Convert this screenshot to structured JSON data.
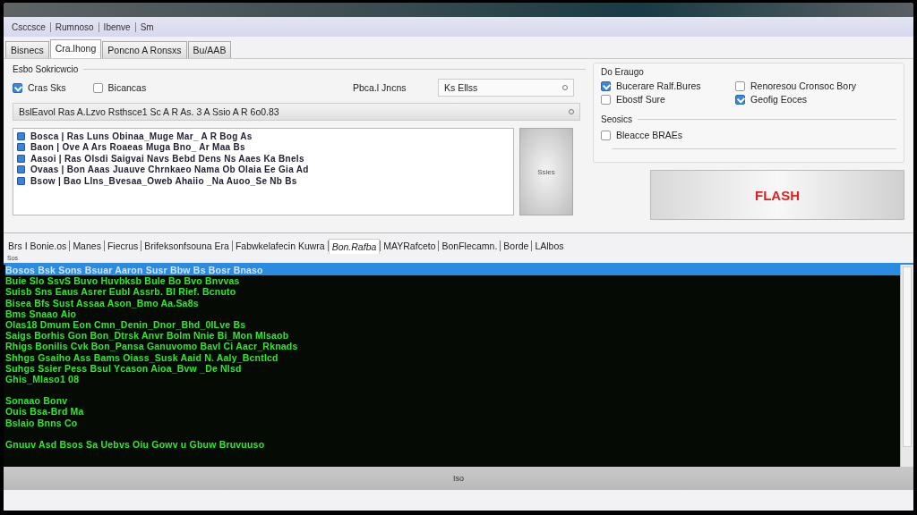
{
  "menu": [
    "Csccsce",
    "Rumnoso",
    "Ibenve",
    "Sm"
  ],
  "tabs": [
    {
      "label": "Bisnecs",
      "selected": false
    },
    {
      "label": "Cra.lhong",
      "selected": true
    },
    {
      "label": "Poncno A Ronsxs",
      "selected": false
    },
    {
      "label": "Bu/AAB",
      "selected": false
    }
  ],
  "settings": {
    "legend": "Esbo Sokricwcio",
    "checkboxes": [
      {
        "label": "Cras Sks",
        "checked": true
      },
      {
        "label": "Bicancas",
        "checked": false
      }
    ],
    "port_label": "Pbca.l Jncns",
    "port_value": "Ks Ellss",
    "file_value": "BslEavol Ras A.Lzvo Rsthsce1 Sc A R As. 3 A Ssio A R 6o0.83",
    "files": [
      "Bosca | Ras Luns Obinaa_Muge Mar_ A R Bog As",
      "Baon | Ove A Ars Roaeas Muga Bno_ Ar Maa Bs",
      "Aasoi | Ras Olsdi Saigvai Navs Bebd Dens Ns Aaes Ka Bnels",
      "Ovaas | Bon Aaas Juauve Chrnkaeo Nama Ob Olaia Ee Gia Ad",
      "Bsow | Bao Llns_Bvesaa_Oweb Ahaiio _Na Auoo_Se Nb Bs"
    ],
    "side_button": "Ssles"
  },
  "options": {
    "legend": "Do Eraugo",
    "checkboxes": [
      {
        "label": "Bucerare Ralf.Bures",
        "checked": true
      },
      {
        "label": "Renoresou Cronsoc Bory",
        "checked": false
      },
      {
        "label": "Ebostf Sure",
        "checked": false
      },
      {
        "label": "Geofig Eoces",
        "checked": true
      }
    ],
    "sub_legend": "Seosics",
    "sub_checkboxes": [
      {
        "label": "Bleacce BRAEs",
        "checked": false
      }
    ]
  },
  "flash_button": "FLASH",
  "log_tabs": [
    {
      "label": "Brs I Bonie.os",
      "selected": false
    },
    {
      "label": "Manes",
      "selected": false
    },
    {
      "label": "Fiecrus",
      "selected": false
    },
    {
      "label": "Brifeksonfsouna Era",
      "selected": false
    },
    {
      "label": "Fabwkelafecin Kuwra",
      "selected": false
    },
    {
      "label": "Bon.Rafba",
      "selected": true
    },
    {
      "label": "MAYRafceto",
      "selected": false
    },
    {
      "label": "BonFlecamn.",
      "selected": false
    },
    {
      "label": "Borde",
      "selected": false
    },
    {
      "label": "LAlbos",
      "selected": false
    }
  ],
  "log_caption": "Sos",
  "log": [
    {
      "text": "Bosos Bsk Sons Bsuar Aaron Susr Bbw Bs Bosr Bnaso",
      "selected": true
    },
    {
      "text": "Buie Slo SsvS Buvo Huvbksb Bule Bo Bvo Bnvvas",
      "selected": false
    },
    {
      "text": "Suisb Sns Eaus Asrer Eubl Assrb. Bl Rief. Bcnuto",
      "selected": false
    },
    {
      "text": "Bisea Bfs Sust Assaa Ason_Bmo Aa.Sa8s",
      "selected": false
    },
    {
      "text": "Bms Snaao Aio",
      "selected": false
    },
    {
      "text": "Olas18 Dmum Eon Cmn_Denin_Dnor_Bhd_0ILve Bs",
      "selected": false
    },
    {
      "text": "Saigs Borhis Gon Bon_Dtrsk Anvr Bolm Nnie Bi_Mon Mlsaob",
      "selected": false
    },
    {
      "text": "Rhigs Bonilis Cvk Bon_Pansa Ganuvomo Bavl Ci Aacr_Rknads",
      "selected": false
    },
    {
      "text": "Shhgs Gsaiho Ass Bams Oiass_Susk Aaid N. Aaly_Bcntlcd",
      "selected": false
    },
    {
      "text": "Suhgs Ssier Pess Bsul Ycason Aioa_Bvw _De Nlsd",
      "selected": false
    },
    {
      "text": "Ghis_Mlaso1 08",
      "selected": false
    },
    {
      "text": "Sonaao Bonv",
      "selected": false,
      "space_before": true
    },
    {
      "text": "Ouis Bsa-Brd Ma",
      "selected": false
    },
    {
      "text": "Bslaio Bnns Co",
      "selected": false
    },
    {
      "text": "Gnuuv Asd Bsos Sa Uebvs Oiu Gowv u Gbuw Bruvuuso",
      "selected": false,
      "space_before": true
    }
  ],
  "status": "Iso"
}
